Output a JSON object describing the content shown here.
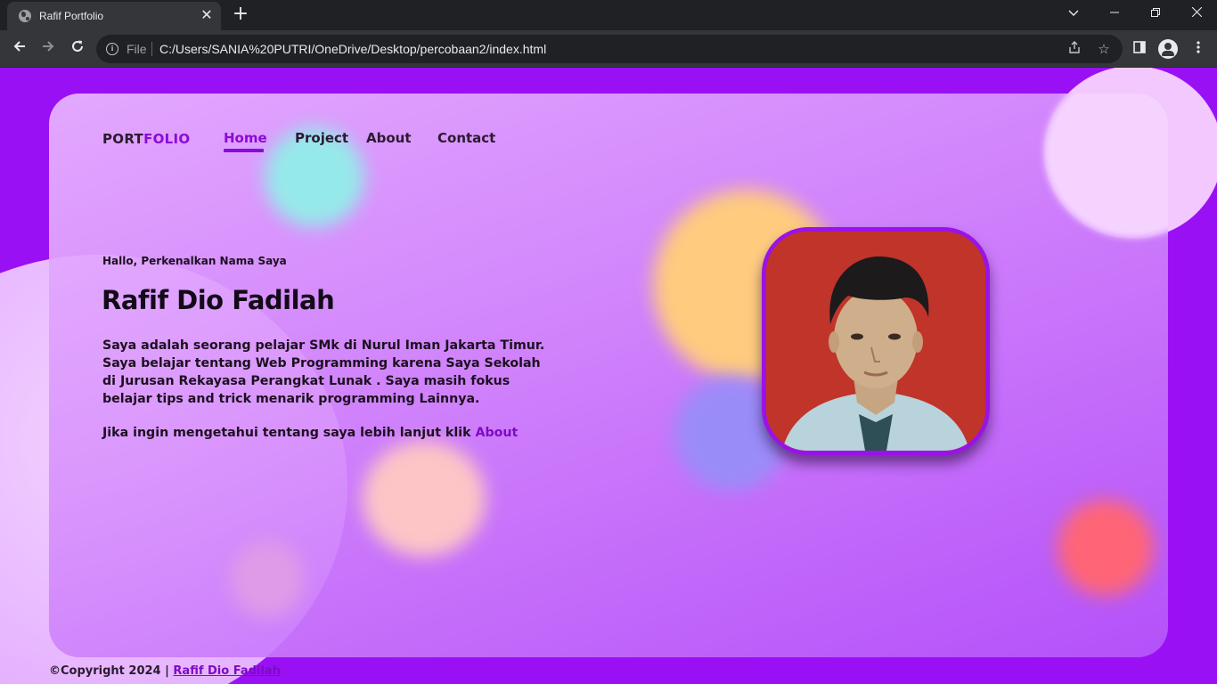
{
  "browser": {
    "tab_title": "Rafif Portfolio",
    "tab_close": "✕",
    "new_tab": "+",
    "omnibox_label": "File",
    "url": "C:/Users/SANIA%20PUTRI/OneDrive/Desktop/percobaan2/index.html"
  },
  "site": {
    "logo_part1": "PORT",
    "logo_part2": "FOLIO",
    "nav": [
      "Home",
      "Project",
      "About",
      "Contact"
    ],
    "active_nav": "Home",
    "greeting": "Hallo, Perkenalkan Nama Saya",
    "name": "Rafif Dio Fadilah",
    "description": "Saya adalah seorang pelajar SMk di Nurul Iman Jakarta Timur. Saya belajar tentang Web Programming karena Saya Sekolah di Jurusan Rekayasa Perangkat Lunak . Saya masih fokus belajar tips and trick menarik programming Lainnya.",
    "cta_text": "Jika ingin mengetahui tentang saya lebih lanjut klik ",
    "cta_link": "About",
    "footer_text": "©Copyright 2024 | ",
    "footer_link": "Rafif Dio Fadilah"
  },
  "colors": {
    "page_bg": "#9a10f5",
    "accent": "#8c0ad8",
    "photo_bg": "#c0342a"
  }
}
